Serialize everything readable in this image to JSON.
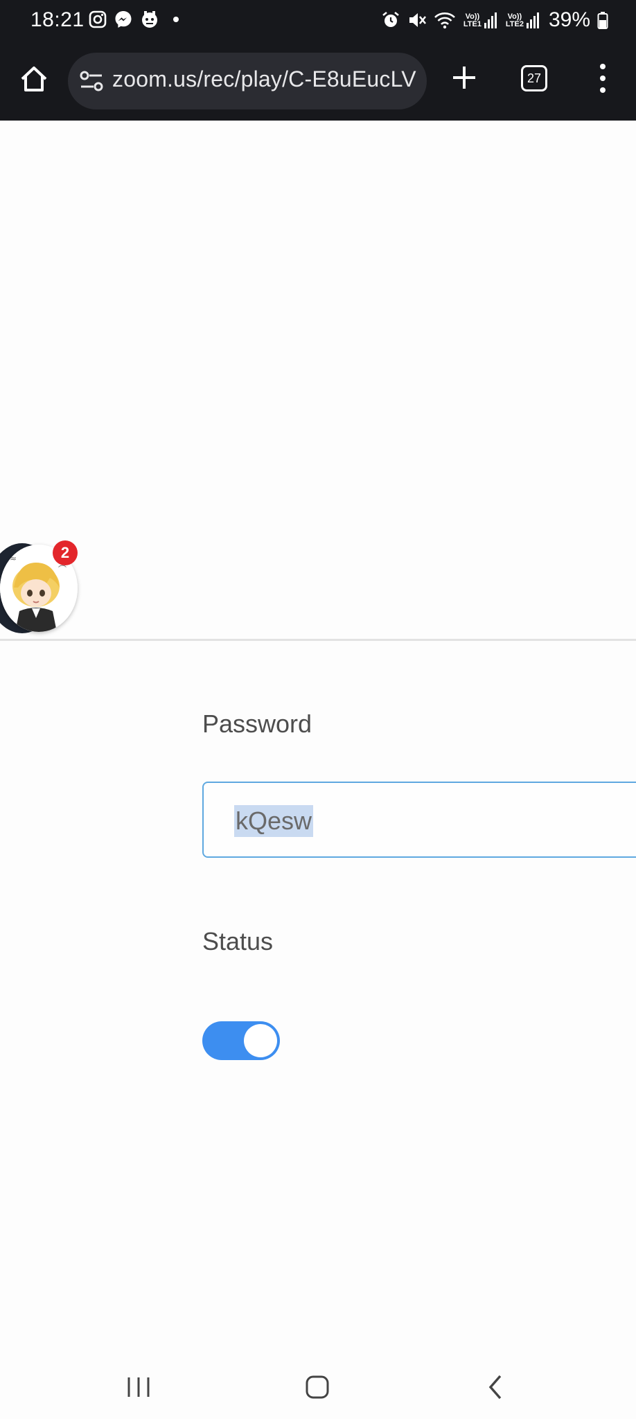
{
  "status_bar": {
    "time": "18:21",
    "net1_label": "Vo)) LTE1",
    "net2_label": "Vo)) LTE2",
    "battery": "39%"
  },
  "browser": {
    "url": "zoom.us/rec/play/C-E8uEucLV",
    "tab_count": "27"
  },
  "chat_head": {
    "badge_count": "2"
  },
  "form": {
    "password_label": "Password",
    "password_value": "kQesw",
    "status_label": "Status",
    "status_enabled": true
  },
  "colors": {
    "toolbar_bg": "#17181c",
    "accent": "#3d8ef0",
    "input_border": "#5ea8e0",
    "badge": "#e3262b"
  }
}
